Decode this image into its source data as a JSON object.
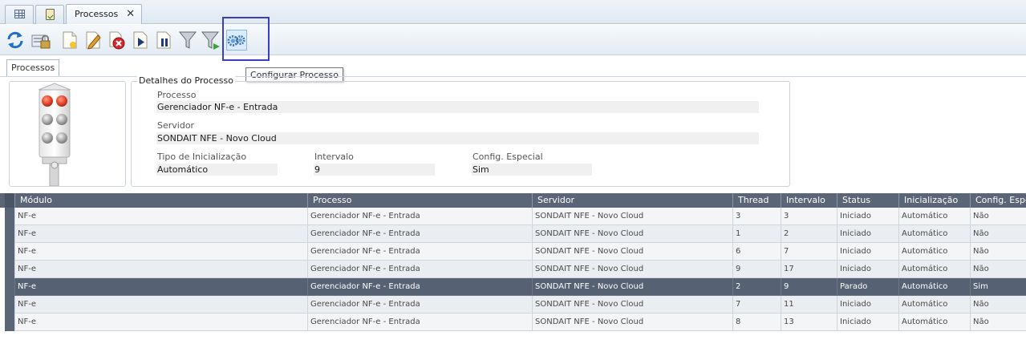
{
  "tabs": {
    "items": [
      {
        "icon": "grid-icon"
      },
      {
        "icon": "clipboard-check-icon"
      },
      {
        "label": "Processos",
        "close": "✕",
        "active": true
      }
    ]
  },
  "toolbar": {
    "buttons": [
      {
        "name": "refresh",
        "icon": "refresh-icon"
      },
      {
        "name": "lock",
        "icon": "lock-icon"
      },
      {
        "name": "new",
        "icon": "new-document-icon"
      },
      {
        "name": "edit",
        "icon": "edit-pencil-icon"
      },
      {
        "name": "delete",
        "icon": "delete-icon"
      },
      {
        "name": "start",
        "icon": "play-icon"
      },
      {
        "name": "pause",
        "icon": "pause-icon"
      },
      {
        "name": "filter",
        "icon": "filter-icon"
      },
      {
        "name": "clear-filter",
        "icon": "filter-clear-icon"
      },
      {
        "name": "configure",
        "icon": "gears-icon"
      }
    ],
    "tooltip": "Configurar Processo"
  },
  "subtab": {
    "label": "Processos"
  },
  "details": {
    "title": "Detalhes do Processo",
    "processo_label": "Processo",
    "processo_value": "Gerenciador NF-e - Entrada",
    "servidor_label": "Servidor",
    "servidor_value": "SONDAIT NFE - Novo Cloud",
    "tipo_label": "Tipo de Inicialização",
    "tipo_value": "Automático",
    "intervalo_label": "Intervalo",
    "intervalo_value": "9",
    "config_label": "Config. Especial",
    "config_value": "Sim",
    "status_light": "red"
  },
  "grid": {
    "columns": [
      "Módulo",
      "Processo",
      "Servidor",
      "Thread",
      "Intervalo",
      "Status",
      "Inicialização",
      "Config. Espe"
    ],
    "rows": [
      [
        "NF-e",
        "Gerenciador NF-e - Entrada",
        "SONDAIT NFE - Novo Cloud",
        "3",
        "3",
        "Iniciado",
        "Automático",
        "Não"
      ],
      [
        "NF-e",
        "Gerenciador NF-e - Entrada",
        "SONDAIT NFE - Novo Cloud",
        "1",
        "2",
        "Iniciado",
        "Automático",
        "Não"
      ],
      [
        "NF-e",
        "Gerenciador NF-e - Entrada",
        "SONDAIT NFE - Novo Cloud",
        "6",
        "7",
        "Iniciado",
        "Automático",
        "Não"
      ],
      [
        "NF-e",
        "Gerenciador NF-e - Entrada",
        "SONDAIT NFE - Novo Cloud",
        "9",
        "17",
        "Iniciado",
        "Automático",
        "Não"
      ],
      [
        "NF-e",
        "Gerenciador NF-e - Entrada",
        "SONDAIT NFE - Novo Cloud",
        "2",
        "9",
        "Parado",
        "Automático",
        "Sim"
      ],
      [
        "NF-e",
        "Gerenciador NF-e - Entrada",
        "SONDAIT NFE - Novo Cloud",
        "7",
        "11",
        "Iniciado",
        "Automático",
        "Não"
      ],
      [
        "NF-e",
        "Gerenciador NF-e - Entrada",
        "SONDAIT NFE - Novo Cloud",
        "8",
        "13",
        "Iniciado",
        "Automático",
        "Não"
      ]
    ],
    "selected_row": 4
  },
  "colors": {
    "header_bg": "#5a6577",
    "selected_row_bg": "#566173",
    "highlight_box": "#3a3ec2"
  }
}
